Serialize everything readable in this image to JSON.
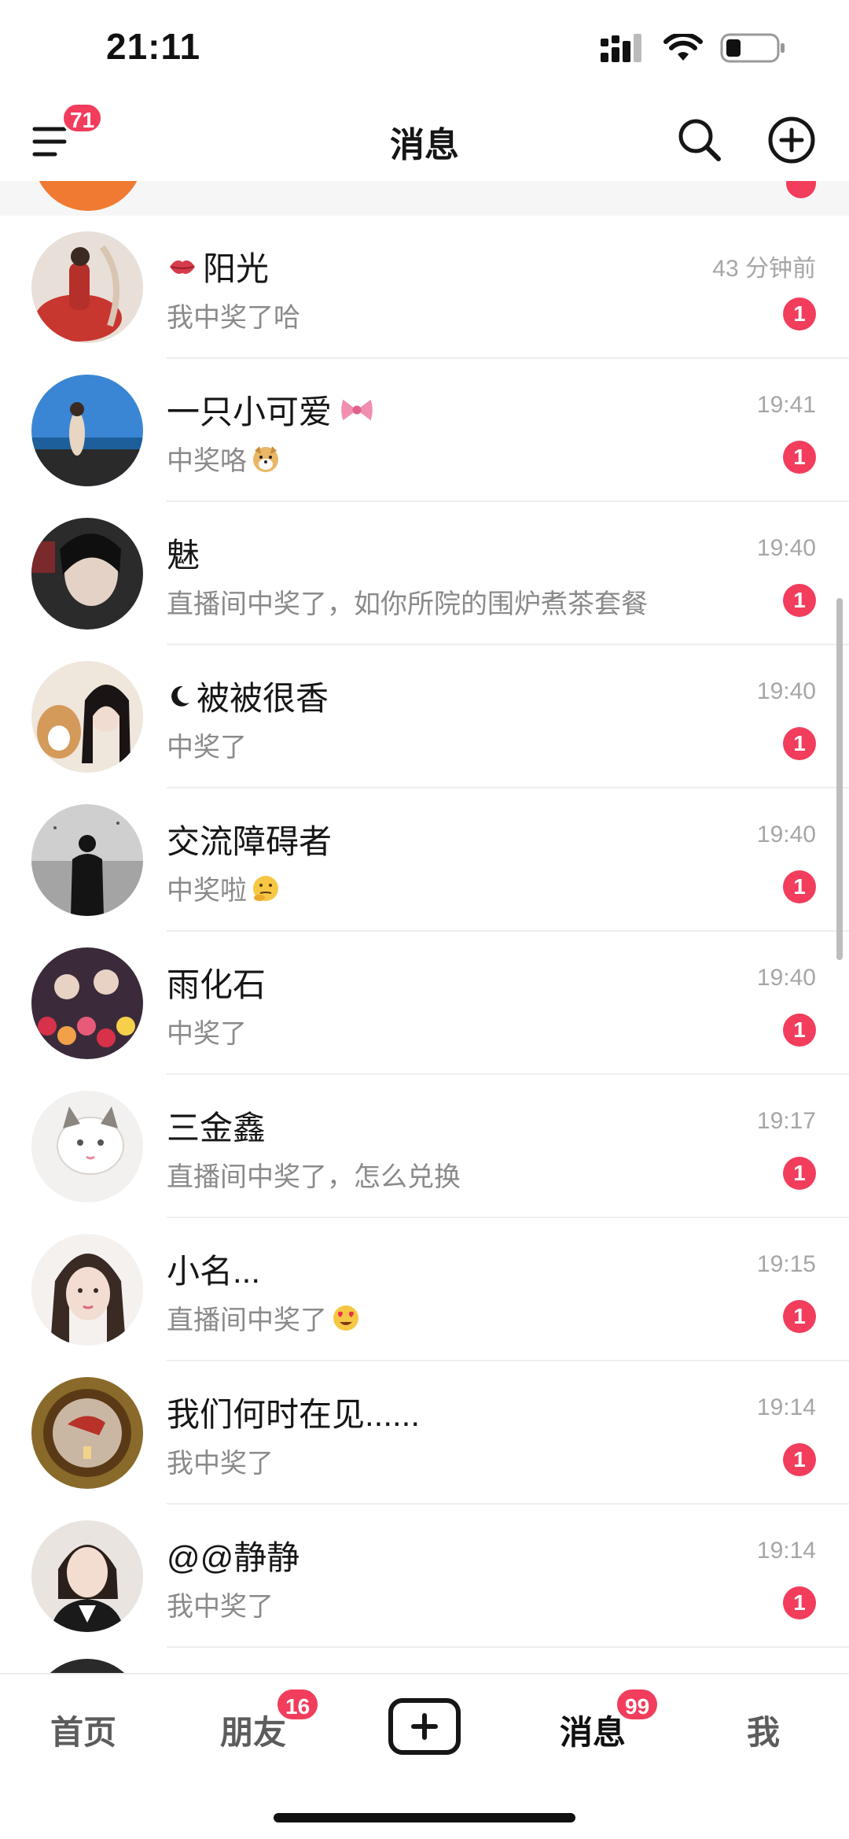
{
  "status_bar": {
    "time": "21:11"
  },
  "header": {
    "title": "消息",
    "menu_badge": "71"
  },
  "conversations": [
    {
      "name": "阳光",
      "name_prefix_icon": "kiss-lips-icon",
      "message": "我中奖了哈",
      "time": "43 分钟前",
      "unread": "1"
    },
    {
      "name": "一只小可爱",
      "name_suffix_icon": "ribbon-bow-icon",
      "message": "中奖咯",
      "message_suffix_icon": "dog-face-icon",
      "time": "19:41",
      "unread": "1"
    },
    {
      "name": "魅",
      "message": "直播间中奖了，如你所院的围炉煮茶套餐",
      "time": "19:40",
      "unread": "1"
    },
    {
      "name": "被被很香",
      "name_prefix_icon": "crescent-moon-icon",
      "message": "中奖了",
      "time": "19:40",
      "unread": "1"
    },
    {
      "name": "交流障碍者",
      "message": "中奖啦",
      "message_suffix_icon": "thinking-face-icon",
      "time": "19:40",
      "unread": "1"
    },
    {
      "name": "雨化石",
      "message": "中奖了",
      "time": "19:40",
      "unread": "1"
    },
    {
      "name": "三金鑫",
      "message": "直播间中奖了，怎么兑换",
      "time": "19:17",
      "unread": "1"
    },
    {
      "name": "小名...",
      "message": "直播间中奖了",
      "message_suffix_icon": "heart-eyes-face-icon",
      "time": "19:15",
      "unread": "1"
    },
    {
      "name": "我们何时在见......",
      "message": "我中奖了",
      "time": "19:14",
      "unread": "1"
    },
    {
      "name": "@@静静",
      "message": "我中奖了",
      "time": "19:14",
      "unread": "1"
    }
  ],
  "tab_bar": {
    "home": "首页",
    "friends": "朋友",
    "friends_badge": "16",
    "messages": "消息",
    "messages_badge": "99",
    "me": "我"
  },
  "colors": {
    "badge_red": "#f23d5c",
    "text_primary": "#161616",
    "text_secondary": "#8a8a8a"
  }
}
